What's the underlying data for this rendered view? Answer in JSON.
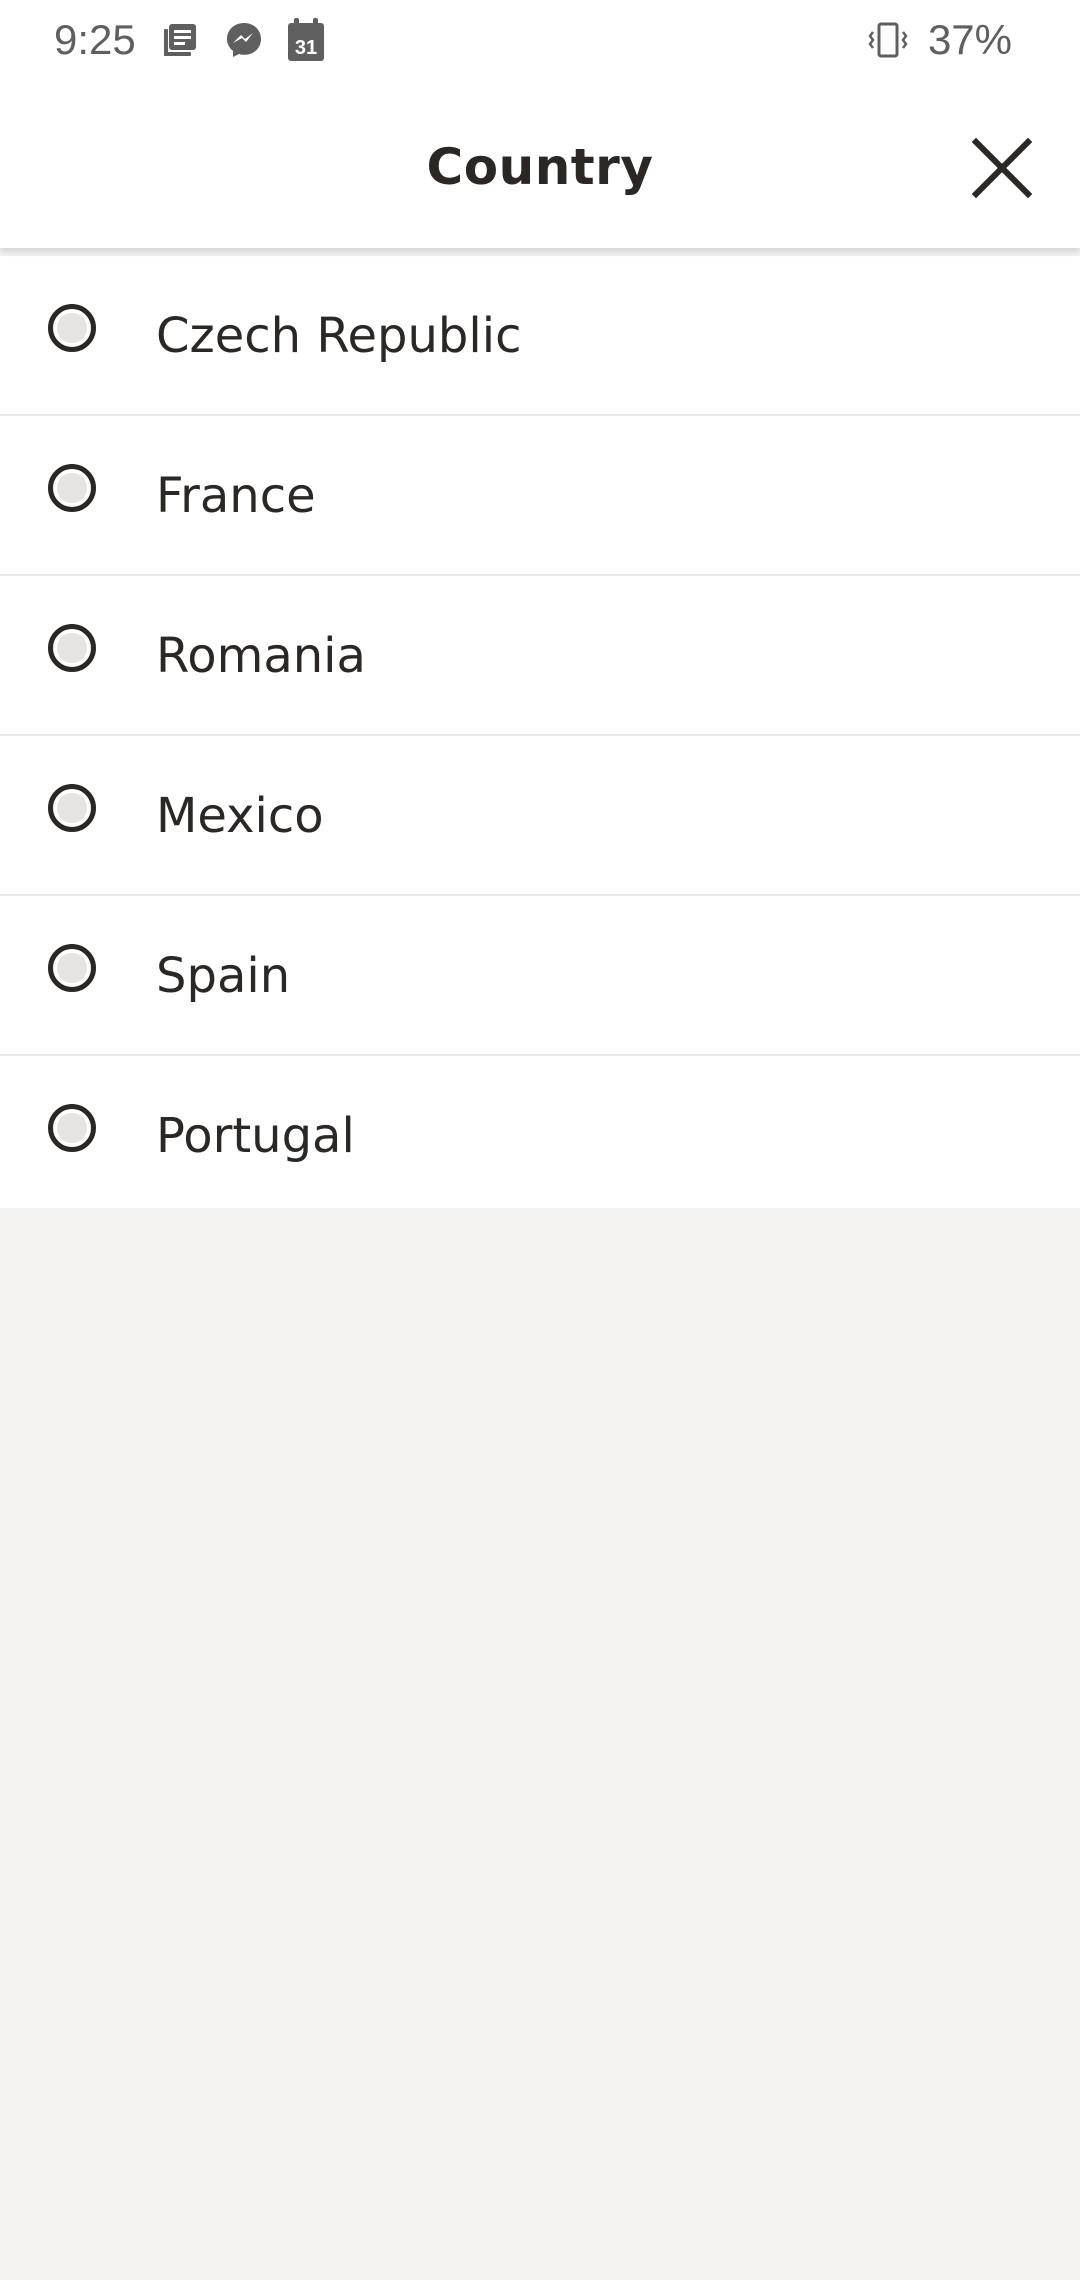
{
  "status_bar": {
    "time": "9:25",
    "battery": "37%",
    "icons": [
      "news-icon",
      "messenger-icon",
      "calendar-icon",
      "vibrate-icon"
    ],
    "calendar_day": "31"
  },
  "header": {
    "title": "Country",
    "close_icon": "close-icon"
  },
  "countries": [
    {
      "label": "Czech Republic",
      "selected": false
    },
    {
      "label": "France",
      "selected": false
    },
    {
      "label": "Romania",
      "selected": false
    },
    {
      "label": "Mexico",
      "selected": false
    },
    {
      "label": "Spain",
      "selected": false
    },
    {
      "label": "Portugal",
      "selected": false
    }
  ],
  "colors": {
    "text": "#2a2725",
    "background": "#f4f3f2",
    "surface": "#ffffff",
    "divider": "#ecebea"
  }
}
